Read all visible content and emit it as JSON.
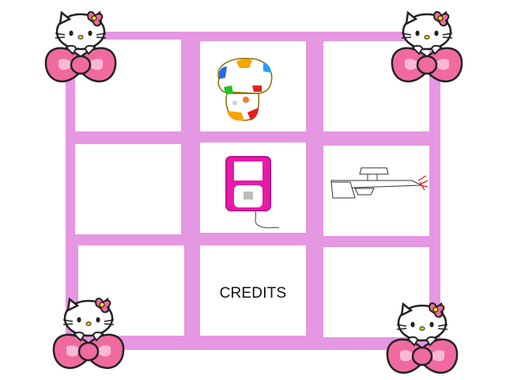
{
  "grid": {
    "frame_color": "#e597e2",
    "cells": [
      {
        "id": "r1c1",
        "content": "empty"
      },
      {
        "id": "r1c2",
        "content": "mushroom",
        "icon": "spotted-mushroom-icon"
      },
      {
        "id": "r1c3",
        "content": "empty"
      },
      {
        "id": "r2c1",
        "content": "empty"
      },
      {
        "id": "r2c2",
        "content": "music-player",
        "icon": "pink-mp3-player-icon"
      },
      {
        "id": "r2c3",
        "content": "rifle",
        "icon": "sniper-rifle-icon"
      },
      {
        "id": "r3c1",
        "content": "empty"
      },
      {
        "id": "r3c2",
        "content": "credits"
      },
      {
        "id": "r3c3",
        "content": "empty"
      }
    ]
  },
  "credits": {
    "label": "CREDITS"
  },
  "decorations": {
    "corner_icon": "hello-kitty-bow-icon",
    "bow_color": "#f06aa0",
    "bow_dark": "#222222"
  }
}
